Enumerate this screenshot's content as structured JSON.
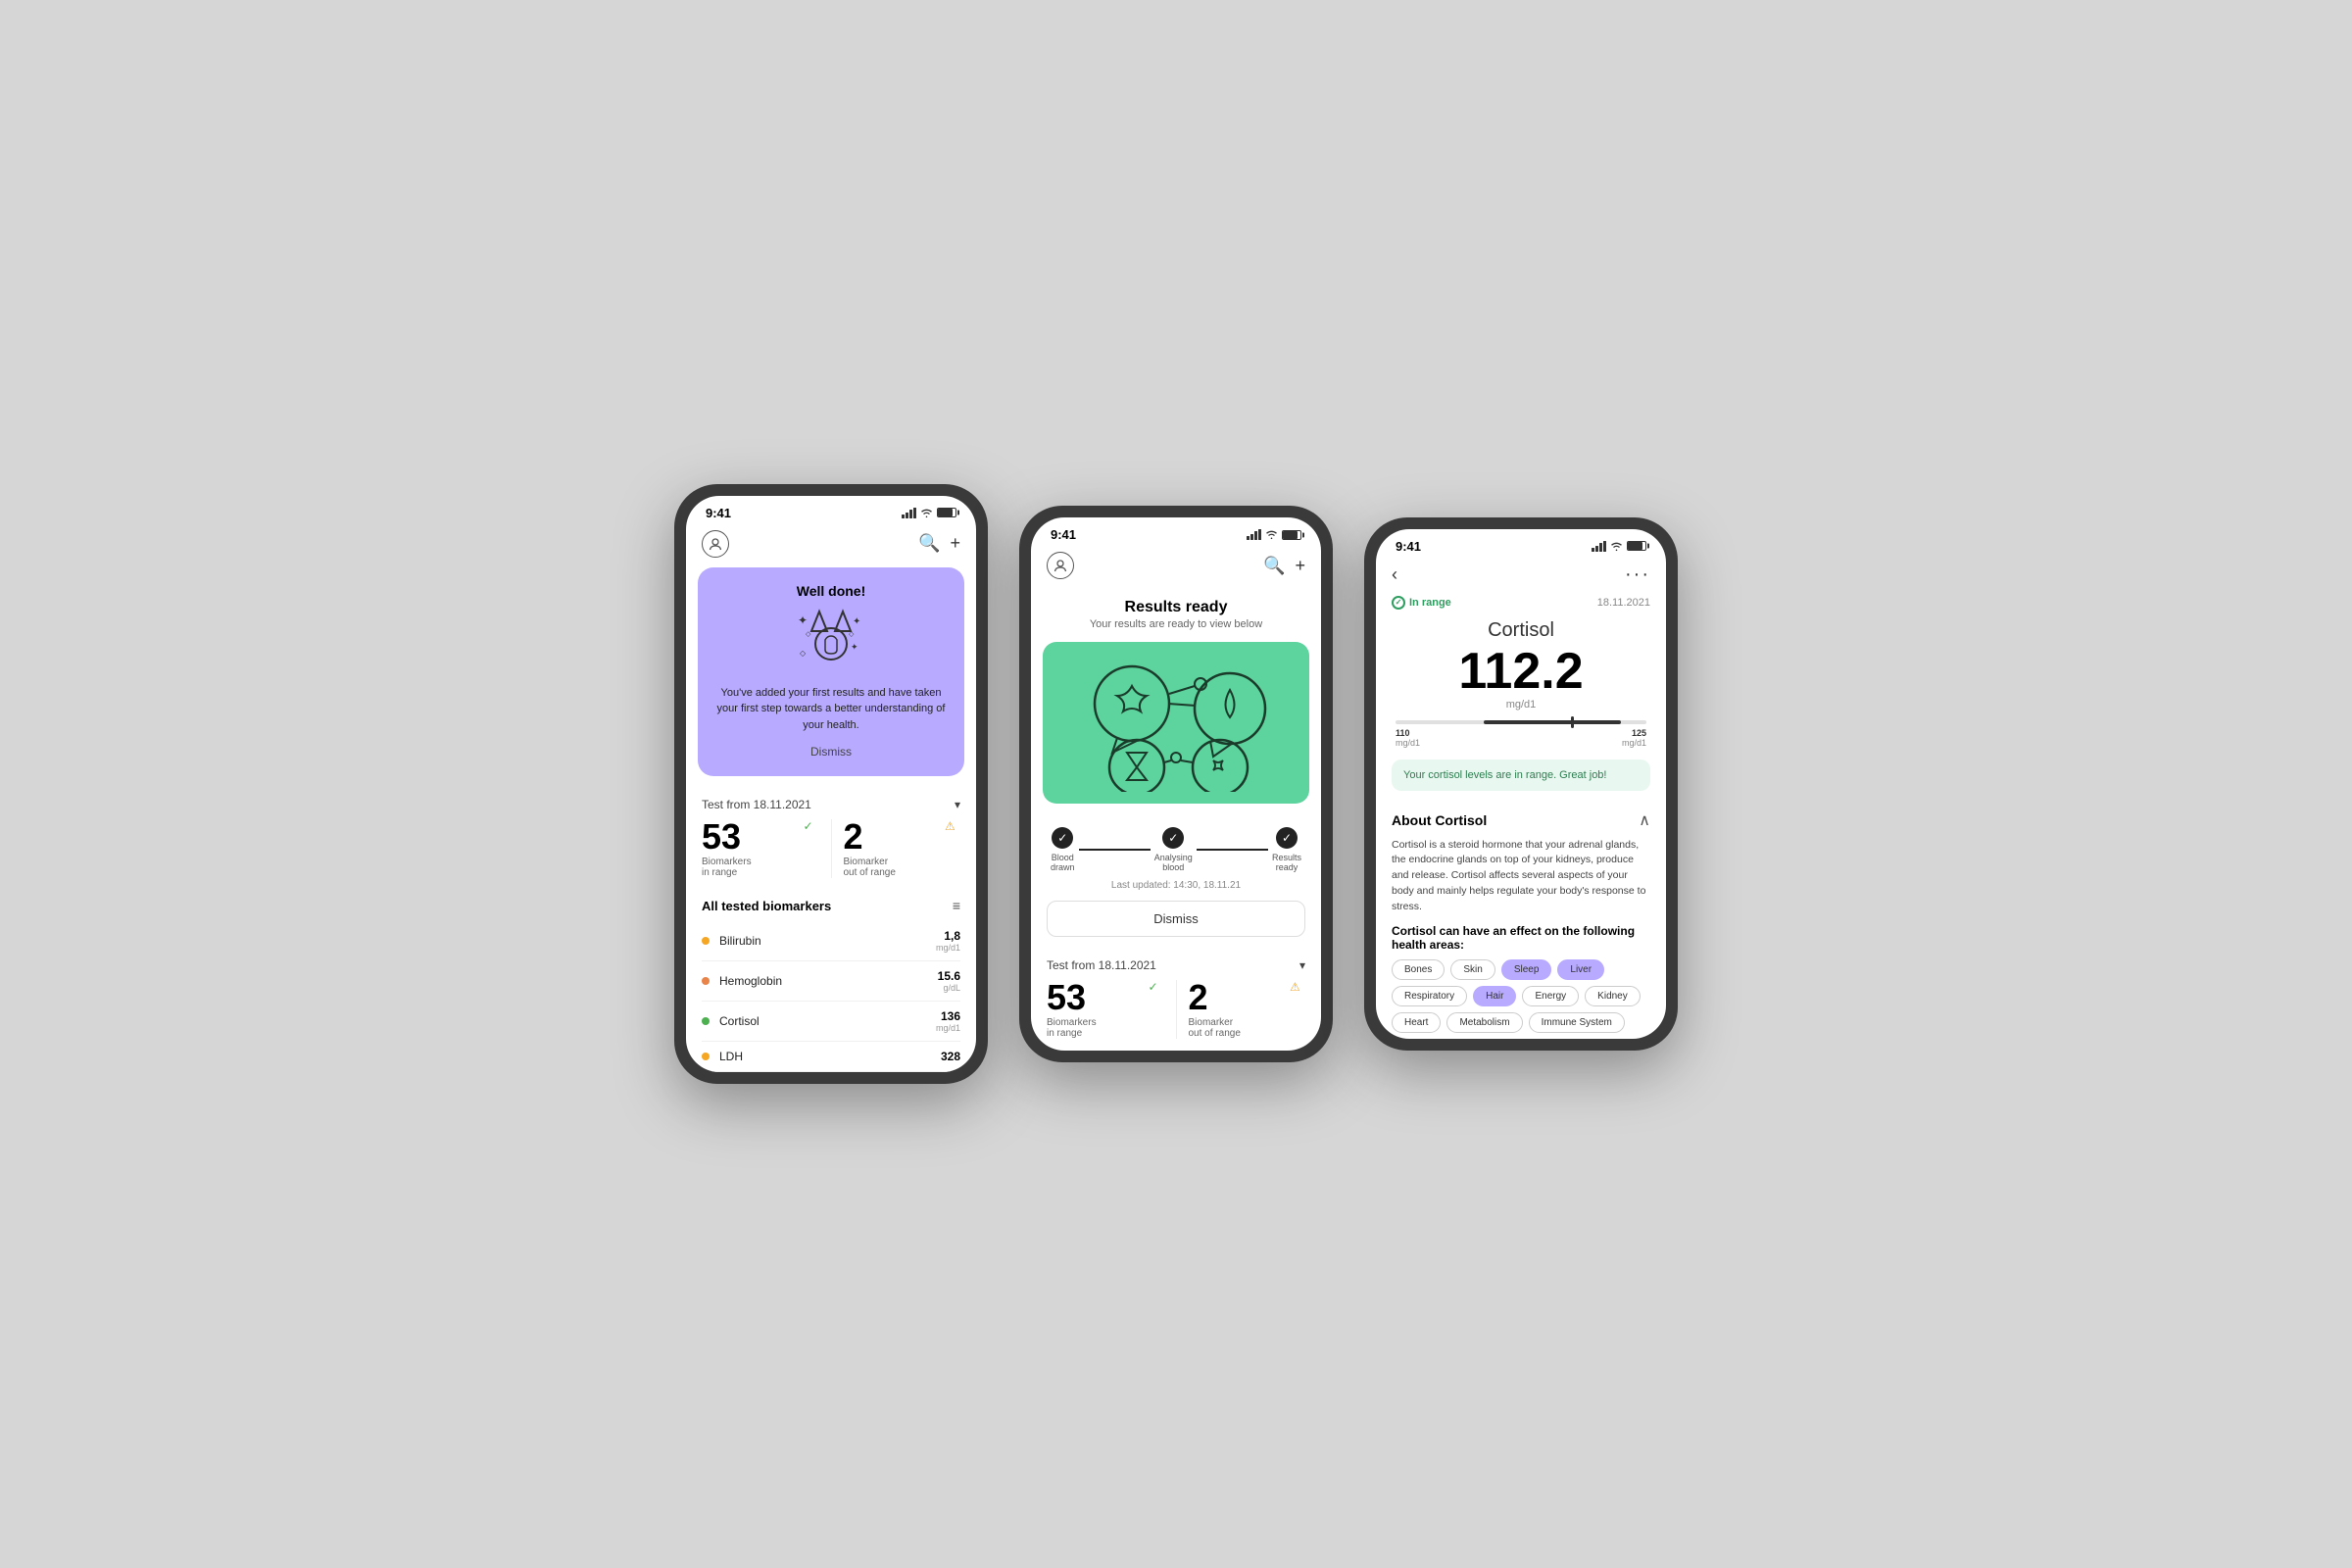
{
  "phone1": {
    "status_time": "9:41",
    "nav_icons": {
      "search": "🔍",
      "add": "+"
    },
    "promo": {
      "title": "Well done!",
      "text": "You've added your first results and have taken your first step towards a better understanding of your health.",
      "dismiss": "Dismiss"
    },
    "test_section": {
      "label": "Test from 18.11.2021",
      "chevron": "▾"
    },
    "stats": {
      "in_range": {
        "number": "53",
        "label": "Biomarkers\nin range"
      },
      "out_range": {
        "number": "2",
        "label": "Biomarker\nout of range"
      }
    },
    "all_biomarkers_title": "All tested biomarkers",
    "biomarkers": [
      {
        "name": "Bilirubin",
        "value": "1,8",
        "unit": "mg/d1",
        "color": "yellow"
      },
      {
        "name": "Hemoglobin",
        "value": "15.6",
        "unit": "g/dL",
        "color": "orange"
      },
      {
        "name": "Cortisol",
        "value": "136",
        "unit": "mg/d1",
        "color": "green"
      },
      {
        "name": "LDH",
        "value": "328",
        "unit": "",
        "color": "yellow"
      }
    ]
  },
  "phone2": {
    "status_time": "9:41",
    "results_title": "Results ready",
    "results_subtitle": "Your results are ready to view below",
    "steps": [
      {
        "label": "Blood\ndrawn",
        "check": "✓"
      },
      {
        "label": "Analysing\nblood",
        "check": "✓"
      },
      {
        "label": "Results\nready",
        "check": "✓"
      }
    ],
    "last_updated": "Last updated: 14:30, 18.11.21",
    "dismiss": "Dismiss",
    "test_section": {
      "label": "Test from 18.11.2021",
      "chevron": "▾"
    },
    "stats": {
      "in_range": {
        "number": "53",
        "label": "Biomarkers\nin range"
      },
      "out_range": {
        "number": "2",
        "label": "Biomarker\nout of range"
      }
    }
  },
  "phone3": {
    "status_time": "9:41",
    "back": "‹",
    "more": "···",
    "status_badge": "In range",
    "date": "18.11.2021",
    "biomarker_name": "Cortisol",
    "biomarker_value": "112.2",
    "biomarker_unit": "mg/d1",
    "range_low": "110\nmg/d1",
    "range_high": "125\nmg/d1",
    "in_range_msg": "Your cortisol levels are in range. Great job!",
    "about_title": "About Cortisol",
    "about_text": "Cortisol is a steroid hormone that your adrenal glands, the endocrine glands on top of your kidneys, produce and release. Cortisol affects several aspects of your body and mainly helps regulate your body's response to stress.",
    "about_subtitle": "Cortisol can have an effect on the following health areas:",
    "health_areas": [
      {
        "label": "Bones",
        "active": false
      },
      {
        "label": "Skin",
        "active": false
      },
      {
        "label": "Sleep",
        "active": true
      },
      {
        "label": "Liver",
        "active": true
      },
      {
        "label": "Respiratory",
        "active": false
      },
      {
        "label": "Hair",
        "active": true
      },
      {
        "label": "Energy",
        "active": false
      },
      {
        "label": "Kidney",
        "active": false
      },
      {
        "label": "Heart",
        "active": false
      },
      {
        "label": "Metabolism",
        "active": false
      },
      {
        "label": "Immune System",
        "active": false
      }
    ]
  }
}
